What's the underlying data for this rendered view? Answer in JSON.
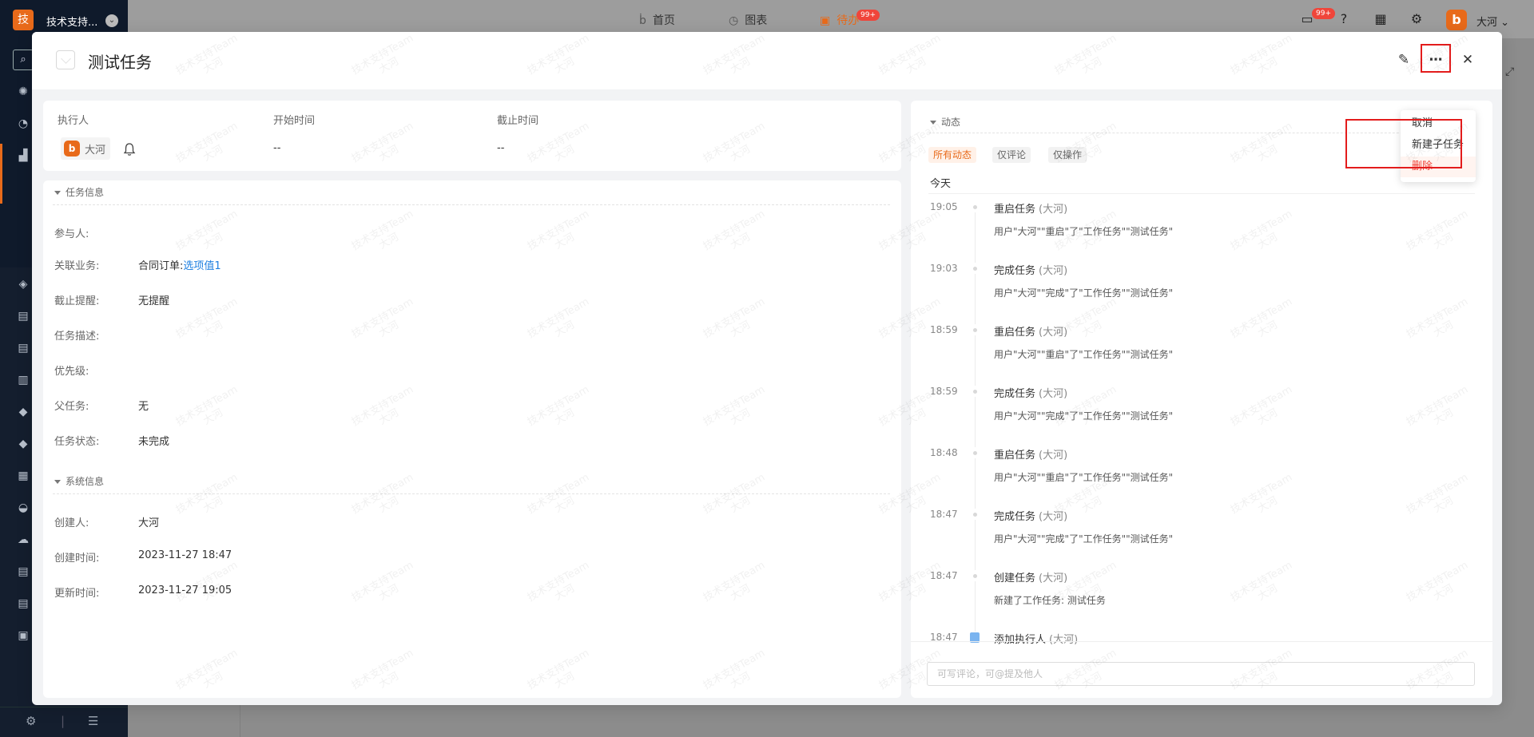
{
  "app": {
    "logo_char": "技",
    "name": "技术支持...",
    "nav": [
      {
        "label": "首页",
        "icon": "logo-b-icon"
      },
      {
        "label": "图表",
        "icon": "chart-icon"
      },
      {
        "label": "待办",
        "icon": "calendar-icon",
        "badge": "99+"
      }
    ],
    "message_badge": "99+",
    "user": {
      "avatar_char": "b",
      "name": "大河"
    }
  },
  "modal": {
    "title": "测试任务",
    "menu": {
      "cancel": "取消",
      "new_subtask": "新建子任务",
      "delete": "删除"
    },
    "summary": {
      "executor_label": "执行人",
      "executor_name": "大河",
      "executor_avatar": "b",
      "start_label": "开始时间",
      "start_value": "--",
      "due_label": "截止时间",
      "due_value": "--"
    },
    "task_info": {
      "section_title": "任务信息",
      "participants_label": "参与人:",
      "related_label": "关联业务:",
      "related_prefix": "合同订单:",
      "related_link": "选项值1",
      "reminder_label": "截止提醒:",
      "reminder_value": "无提醒",
      "desc_label": "任务描述:",
      "priority_label": "优先级:",
      "parent_label": "父任务:",
      "parent_value": "无",
      "status_label": "任务状态:",
      "status_value": "未完成"
    },
    "system_info": {
      "section_title": "系统信息",
      "creator_label": "创建人:",
      "creator_value": "大河",
      "created_label": "创建时间:",
      "created_value": "2023-11-27 18:47",
      "updated_label": "更新时间:",
      "updated_value": "2023-11-27 19:05"
    },
    "activity": {
      "section_title": "动态",
      "filters": [
        "所有动态",
        "仅评论",
        "仅操作"
      ],
      "active_filter": "所有动态",
      "day_label": "今天",
      "items": [
        {
          "time": "19:05",
          "action": "重启任务",
          "who": "(大河)",
          "desc": "用户\"大河\"\"重启\"了\"工作任务\"\"测试任务\""
        },
        {
          "time": "19:03",
          "action": "完成任务",
          "who": "(大河)",
          "desc": "用户\"大河\"\"完成\"了\"工作任务\"\"测试任务\""
        },
        {
          "time": "18:59",
          "action": "重启任务",
          "who": "(大河)",
          "desc": "用户\"大河\"\"重启\"了\"工作任务\"\"测试任务\""
        },
        {
          "time": "18:59",
          "action": "完成任务",
          "who": "(大河)",
          "desc": "用户\"大河\"\"完成\"了\"工作任务\"\"测试任务\""
        },
        {
          "time": "18:48",
          "action": "重启任务",
          "who": "(大河)",
          "desc": "用户\"大河\"\"重启\"了\"工作任务\"\"测试任务\""
        },
        {
          "time": "18:47",
          "action": "完成任务",
          "who": "(大河)",
          "desc": "用户\"大河\"\"完成\"了\"工作任务\"\"测试任务\""
        },
        {
          "time": "18:47",
          "action": "创建任务",
          "who": "(大河)",
          "desc": "新建了工作任务: 测试任务"
        },
        {
          "time": "18:47",
          "action": "添加执行人",
          "who": "(大河)",
          "desc": ""
        }
      ],
      "comment_placeholder": "可写评论，可@提及他人"
    },
    "watermark": {
      "line1": "技术支持Team",
      "line2": "大河"
    }
  },
  "colors": {
    "accent": "#e86a1a",
    "danger": "#f0453a",
    "link": "#1e7fe0",
    "highlight": "#e31c1c"
  }
}
